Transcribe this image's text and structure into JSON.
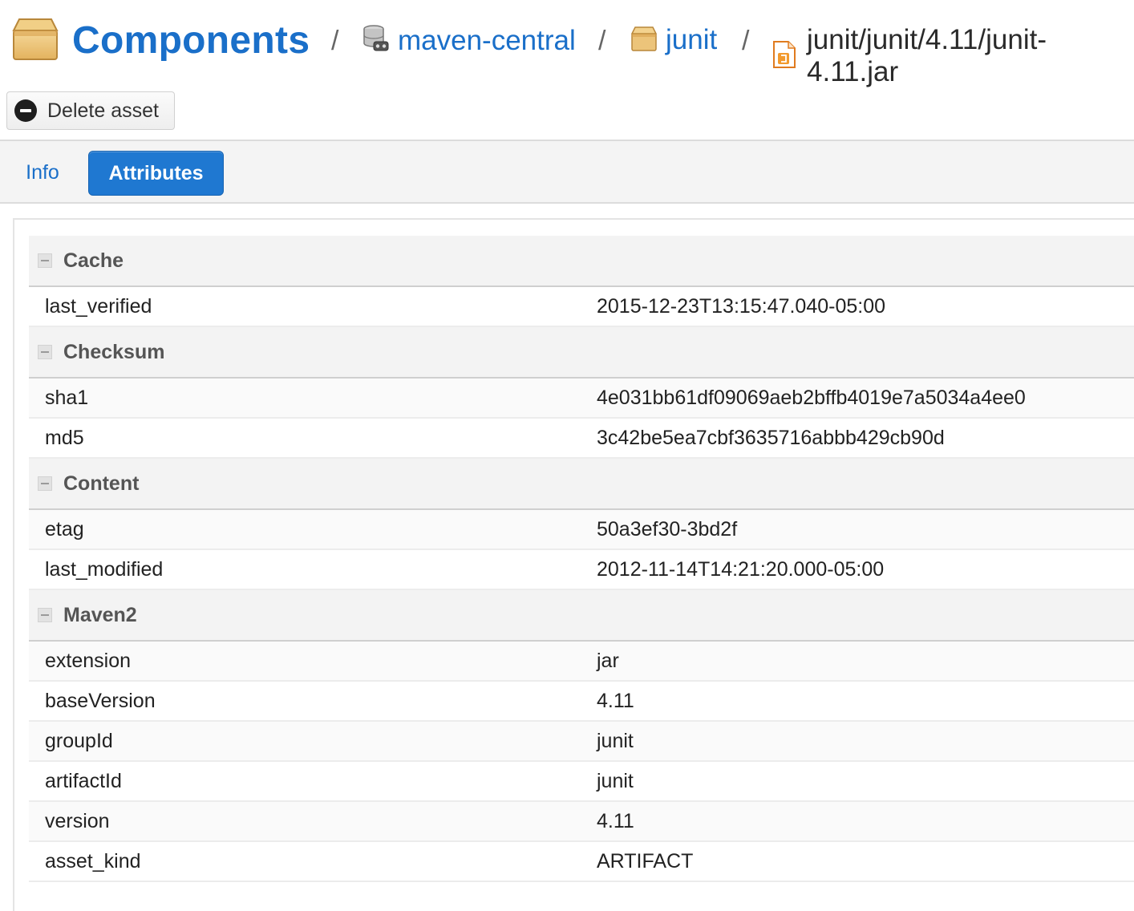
{
  "breadcrumb": {
    "title": "Components",
    "separator": "/",
    "repository": "maven-central",
    "component": "junit",
    "asset": "junit/junit/4.11/junit-4.11.jar",
    "icons": [
      "box-icon",
      "repository-icon",
      "box-icon",
      "jar-file-icon"
    ]
  },
  "toolbar": {
    "delete_label": "Delete asset"
  },
  "tabs": [
    {
      "label": "Info",
      "active": false
    },
    {
      "label": "Attributes",
      "active": true
    }
  ],
  "colors": {
    "accent": "#1a6fc9",
    "active_tab": "#1f78d1"
  },
  "groups": [
    {
      "label": "Cache",
      "rows": [
        {
          "key": "last_verified",
          "value": "2015-12-23T13:15:47.040-05:00"
        }
      ]
    },
    {
      "label": "Checksum",
      "rows": [
        {
          "key": "sha1",
          "value": "4e031bb61df09069aeb2bffb4019e7a5034a4ee0"
        },
        {
          "key": "md5",
          "value": "3c42be5ea7cbf3635716abbb429cb90d"
        }
      ]
    },
    {
      "label": "Content",
      "rows": [
        {
          "key": "etag",
          "value": "50a3ef30-3bd2f"
        },
        {
          "key": "last_modified",
          "value": "2012-11-14T14:21:20.000-05:00"
        }
      ]
    },
    {
      "label": "Maven2",
      "rows": [
        {
          "key": "extension",
          "value": "jar"
        },
        {
          "key": "baseVersion",
          "value": "4.11"
        },
        {
          "key": "groupId",
          "value": "junit"
        },
        {
          "key": "artifactId",
          "value": "junit"
        },
        {
          "key": "version",
          "value": "4.11"
        },
        {
          "key": "asset_kind",
          "value": "ARTIFACT"
        }
      ]
    }
  ]
}
